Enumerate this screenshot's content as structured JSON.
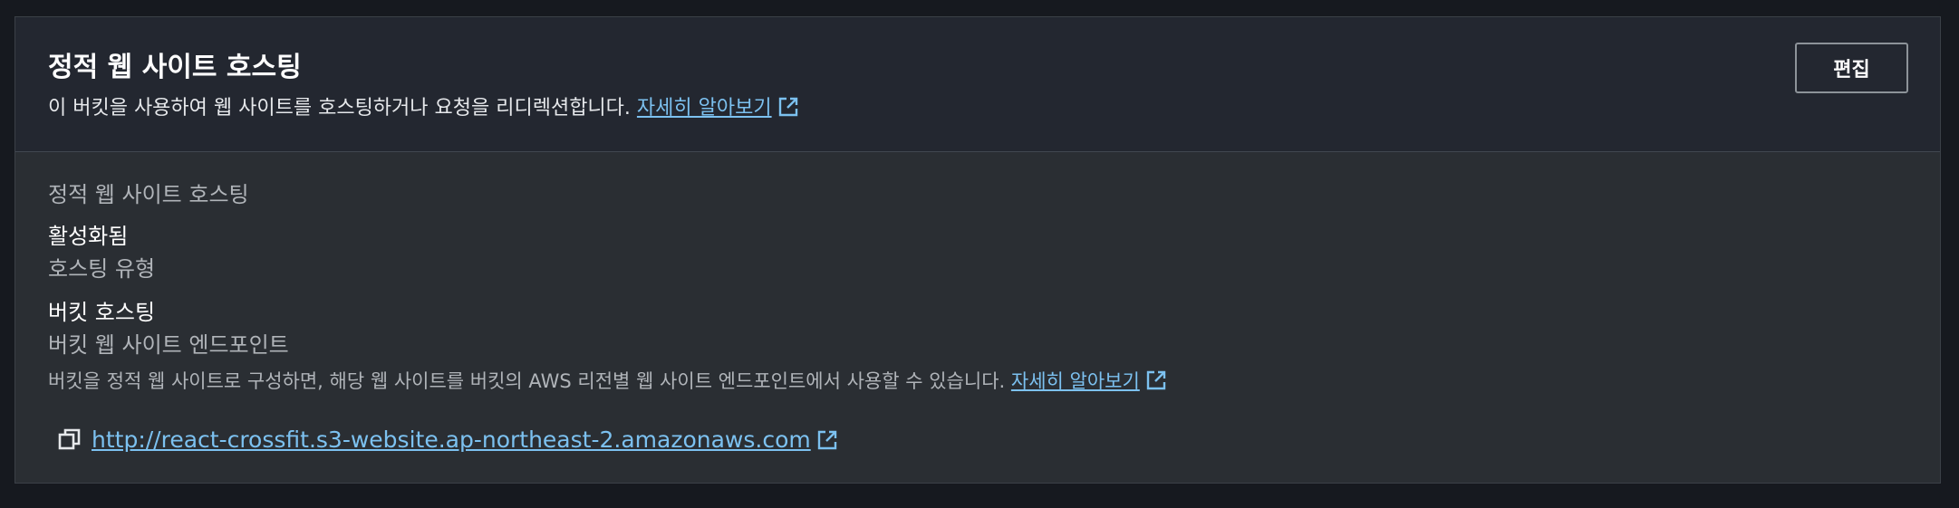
{
  "header": {
    "title": "정적 웹 사이트 호스팅",
    "description": "이 버킷을 사용하여 웹 사이트를 호스팅하거나 요청을 리디렉션합니다.",
    "learn_more": "자세히 알아보기",
    "edit_label": "편집"
  },
  "body": {
    "section_label": "정적 웹 사이트 호스팅",
    "status_value": "활성화됨",
    "hosting_type_label": "호스팅 유형",
    "hosting_type_value": "버킷 호스팅",
    "endpoint_label": "버킷 웹 사이트 엔드포인트",
    "endpoint_description": "버킷을 정적 웹 사이트로 구성하면, 해당 웹 사이트를 버킷의 AWS 리전별 웹 사이트 엔드포인트에서 사용할 수 있습니다.",
    "learn_more": "자세히 알아보기",
    "endpoint_url": "http://react-crossfit.s3-website.ap-northeast-2.amazonaws.com"
  },
  "icons": {
    "external": "external-link-icon",
    "copy": "copy-icon"
  },
  "colors": {
    "link": "#7cc1f0",
    "background": "#16191f",
    "panel": "#2a2e33",
    "header": "#232730"
  }
}
